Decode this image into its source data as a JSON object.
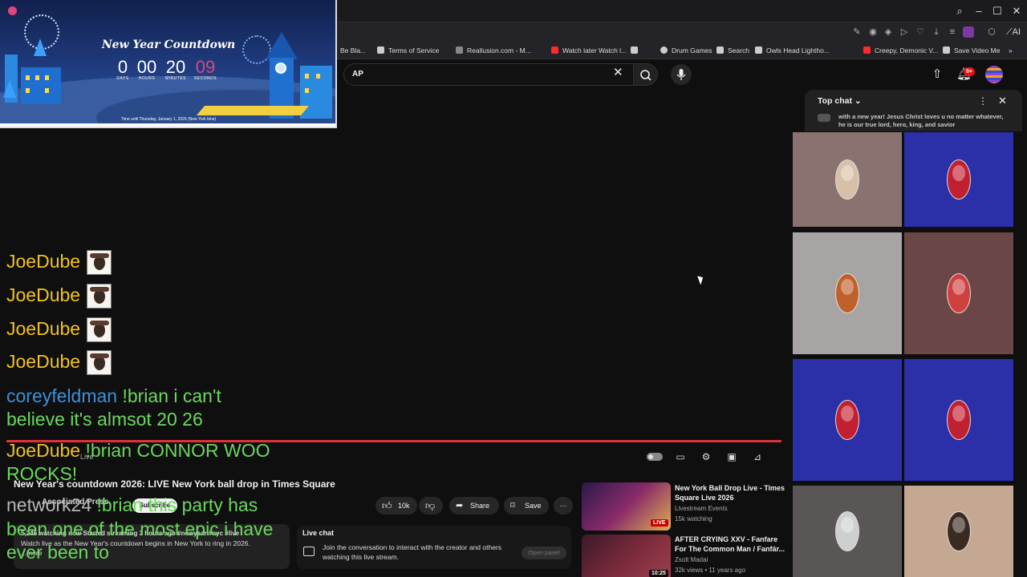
{
  "bookmarks": [
    {
      "label": "Be Bla...",
      "color": "#3a3a3a"
    },
    {
      "label": "Terms of Service",
      "color": "#cccccc"
    },
    {
      "label": "Reallusion.com - M...",
      "color": "#888888"
    },
    {
      "label": "Watch later Watch l...",
      "color": "#ff2a2a"
    },
    {
      "label": "Drum Games",
      "color": "#cccccc"
    },
    {
      "label": "Search",
      "color": "#cccccc"
    },
    {
      "label": "Owls Head Lightho...",
      "color": "#cccccc"
    },
    {
      "label": "Creepy, Demonic V...",
      "color": "#ff2a2a"
    },
    {
      "label": "Save Video Me",
      "color": "#cccccc"
    }
  ],
  "toolbar": {
    "ai_label": "AI"
  },
  "header": {
    "search_value": "AP",
    "notification_count": "9+"
  },
  "countdown": {
    "title": "New Year Countdown",
    "days": "0",
    "hours": "00",
    "minutes": "20",
    "seconds": "09",
    "labels": [
      "DAYS",
      "HOURS",
      "MINUTES",
      "SECONDS"
    ],
    "footer": "Time until Thursday, January 1, 2026 (New York time)",
    "accent": "#e0457b"
  },
  "overlay_chat": [
    {
      "user": "JoeDube",
      "text": "",
      "emote": true
    },
    {
      "user": "JoeDube",
      "text": "",
      "emote": true
    },
    {
      "user": "JoeDube",
      "text": "",
      "emote": true
    },
    {
      "user": "JoeDube",
      "text": "",
      "emote": true
    },
    {
      "user": "coreyfeldman",
      "line1": "!brian i can't",
      "line2": "believe it's almsot 20 26"
    },
    {
      "user": "JoeDube",
      "line1": "!brian CONNOR WOO",
      "line2": "ROCKS!"
    },
    {
      "user": "network24",
      "line1": "!brian this party has",
      "line2": "been one of the most epic i have",
      "line3": "ever been to"
    }
  ],
  "player": {
    "live_label": "Live"
  },
  "video": {
    "title": "New Year's countdown 2026: LIVE New York ball drop in Times Square",
    "channel": "Associated Press",
    "subscribe_label": "Subscribe",
    "likes": "10k",
    "share_label": "Share",
    "save_label": "Save",
    "description_line1": "5,246 watching now  Started streaming 3 hours ago  #newyear #nyc #live",
    "description_line2": "Watch live as the New Year's countdown begins in New York to ring in 2026.",
    "description_line3": "...more"
  },
  "live_chat_box": {
    "title": "Live chat",
    "text": "Join the conversation to interact with the creator and others watching this live stream.",
    "button": "Open panel"
  },
  "recommendations": [
    {
      "title": "New York Ball Drop Live - Times",
      "title2": "Square Live 2026",
      "channel": "Livestream Events",
      "meta": "15k watching",
      "badge": "LIVE"
    },
    {
      "title": "AFTER CRYING XXV - Fanfare",
      "title2": "For The Common Man / Fanfár...",
      "channel": "Zsolt Madai",
      "meta": "32k views • 11 years ago",
      "badge": "10:25"
    }
  ],
  "chat_panel": {
    "title": "Top chat",
    "preview": "with a new year! Jesus Christ loves u no matter whatever, he is our true lord, hero, king, and savior"
  },
  "participants": [
    {
      "bg": "#8a7270",
      "face": "#d8c0a8"
    },
    {
      "bg": "#2b2fa8",
      "face": "#c02030"
    },
    {
      "bg": "#a8a4a4",
      "face": "#c0602a"
    },
    {
      "bg": "#6a4646",
      "face": "#d04040"
    },
    {
      "bg": "#2b2fa8",
      "face": "#c02030"
    },
    {
      "bg": "#2b2fa8",
      "face": "#c02030"
    },
    {
      "bg": "#5a5656",
      "face": "#cfcfcf"
    },
    {
      "bg": "#c4a891",
      "face": "#3a2a20"
    }
  ]
}
